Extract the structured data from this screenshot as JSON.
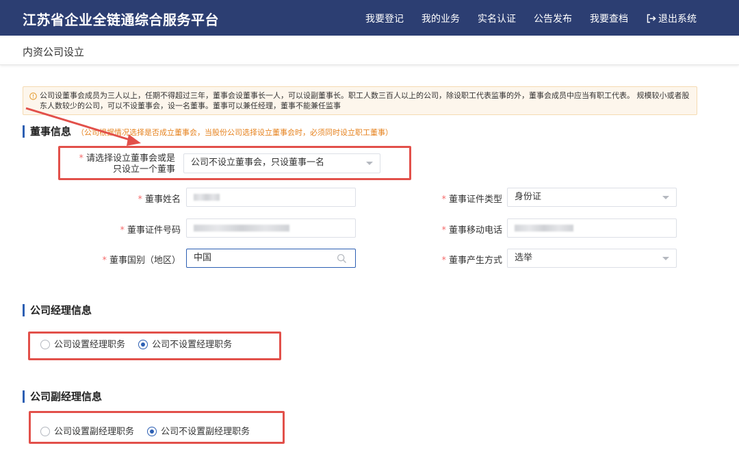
{
  "header": {
    "brand": "江苏省企业全链通综合服务平台",
    "nav": [
      "我要登记",
      "我的业务",
      "实名认证",
      "公告发布",
      "我要查档"
    ],
    "logout": "退出系统"
  },
  "page_title": "内资公司设立",
  "notice": {
    "text": "公司设董事会成员为三人以上，任期不得超过三年，董事会设董事长一人，可以设副董事长。职工人数三百人以上的公司，除设职工代表监事的外，董事会成员中应当有职工代表。 规模较小或者股东人数较少的公司，可以不设董事会，设一名董事。董事可以兼任经理，董事不能兼任监事"
  },
  "director": {
    "title": "董事信息",
    "hint": "（公司根据情况选择是否成立董事会，当股份公司选择设立董事会时，必须同时设立职工董事）",
    "board_choice": {
      "label_line1": "请选择设立董事会或是",
      "label_line2": "只设立一个董事",
      "value": "公司不设立董事会，只设董事一名"
    },
    "name_label": "董事姓名",
    "id_type_label": "董事证件类型",
    "id_type_value": "身份证",
    "id_no_label": "董事证件号码",
    "mobile_label": "董事移动电话",
    "nationality_label": "董事国别（地区）",
    "nationality_value": "中国",
    "method_label": "董事产生方式",
    "method_value": "选举"
  },
  "manager": {
    "title": "公司经理信息",
    "option_yes": "公司设置经理职务",
    "option_no": "公司不设置经理职务"
  },
  "deputy": {
    "title": "公司副经理信息",
    "option_yes": "公司设置副经理职务",
    "option_no": "公司不设置副经理职务"
  },
  "colors": {
    "header_bg": "#2c3e72",
    "accent": "#2c5fb3",
    "highlight": "#e2504a",
    "required": "#f56c6c",
    "hint": "#e6821e"
  }
}
